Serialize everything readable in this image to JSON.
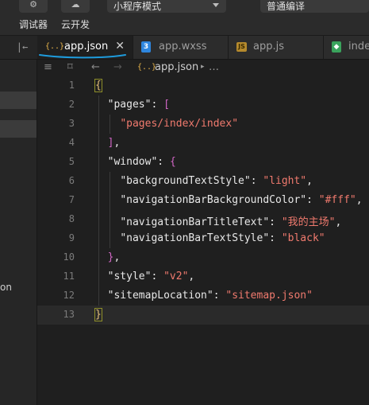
{
  "toolbar": {
    "debugger_label": "调试器",
    "cloud_label": "云开发",
    "mode_select_value": "小程序模式",
    "compile_select_value": "普通编译"
  },
  "left_panel": {
    "item_partial": "on"
  },
  "tabs": [
    {
      "label": "app.json",
      "icon": "json-icon",
      "active": true
    },
    {
      "label": "app.wxss",
      "icon": "css-icon",
      "active": false
    },
    {
      "label": "app.js",
      "icon": "js-icon",
      "active": false
    },
    {
      "label": "inde",
      "icon": "wxml-icon",
      "active": false
    }
  ],
  "breadcrumb": {
    "file": "app.json",
    "more": "…"
  },
  "editor": {
    "line_numbers": [
      "1",
      "2",
      "3",
      "4",
      "5",
      "6",
      "7",
      "8",
      "9",
      "10",
      "11",
      "12",
      "13"
    ],
    "keys": {
      "pages": "\"pages\"",
      "window": "\"window\"",
      "backgroundTextStyle": "\"backgroundTextStyle\"",
      "navigationBarBackgroundColor": "\"navigationBarBackgroundColor\"",
      "navigationBarTitleText": "\"navigationBarTitleText\"",
      "navigationBarTextStyle": "\"navigationBarTextStyle\"",
      "style": "\"style\"",
      "sitemapLocation": "\"sitemapLocation\""
    },
    "values": {
      "page_index": "\"pages/index/index\"",
      "light": "\"light\"",
      "fff": "\"#fff\"",
      "title": "\"我的主场\"",
      "black": "\"black\"",
      "v2": "\"v2\"",
      "sitemap": "\"sitemap.json\""
    }
  },
  "colors": {
    "accent_underline": "#1e9bdc",
    "string": "#f07a6e",
    "bracket": "#d166c5"
  }
}
